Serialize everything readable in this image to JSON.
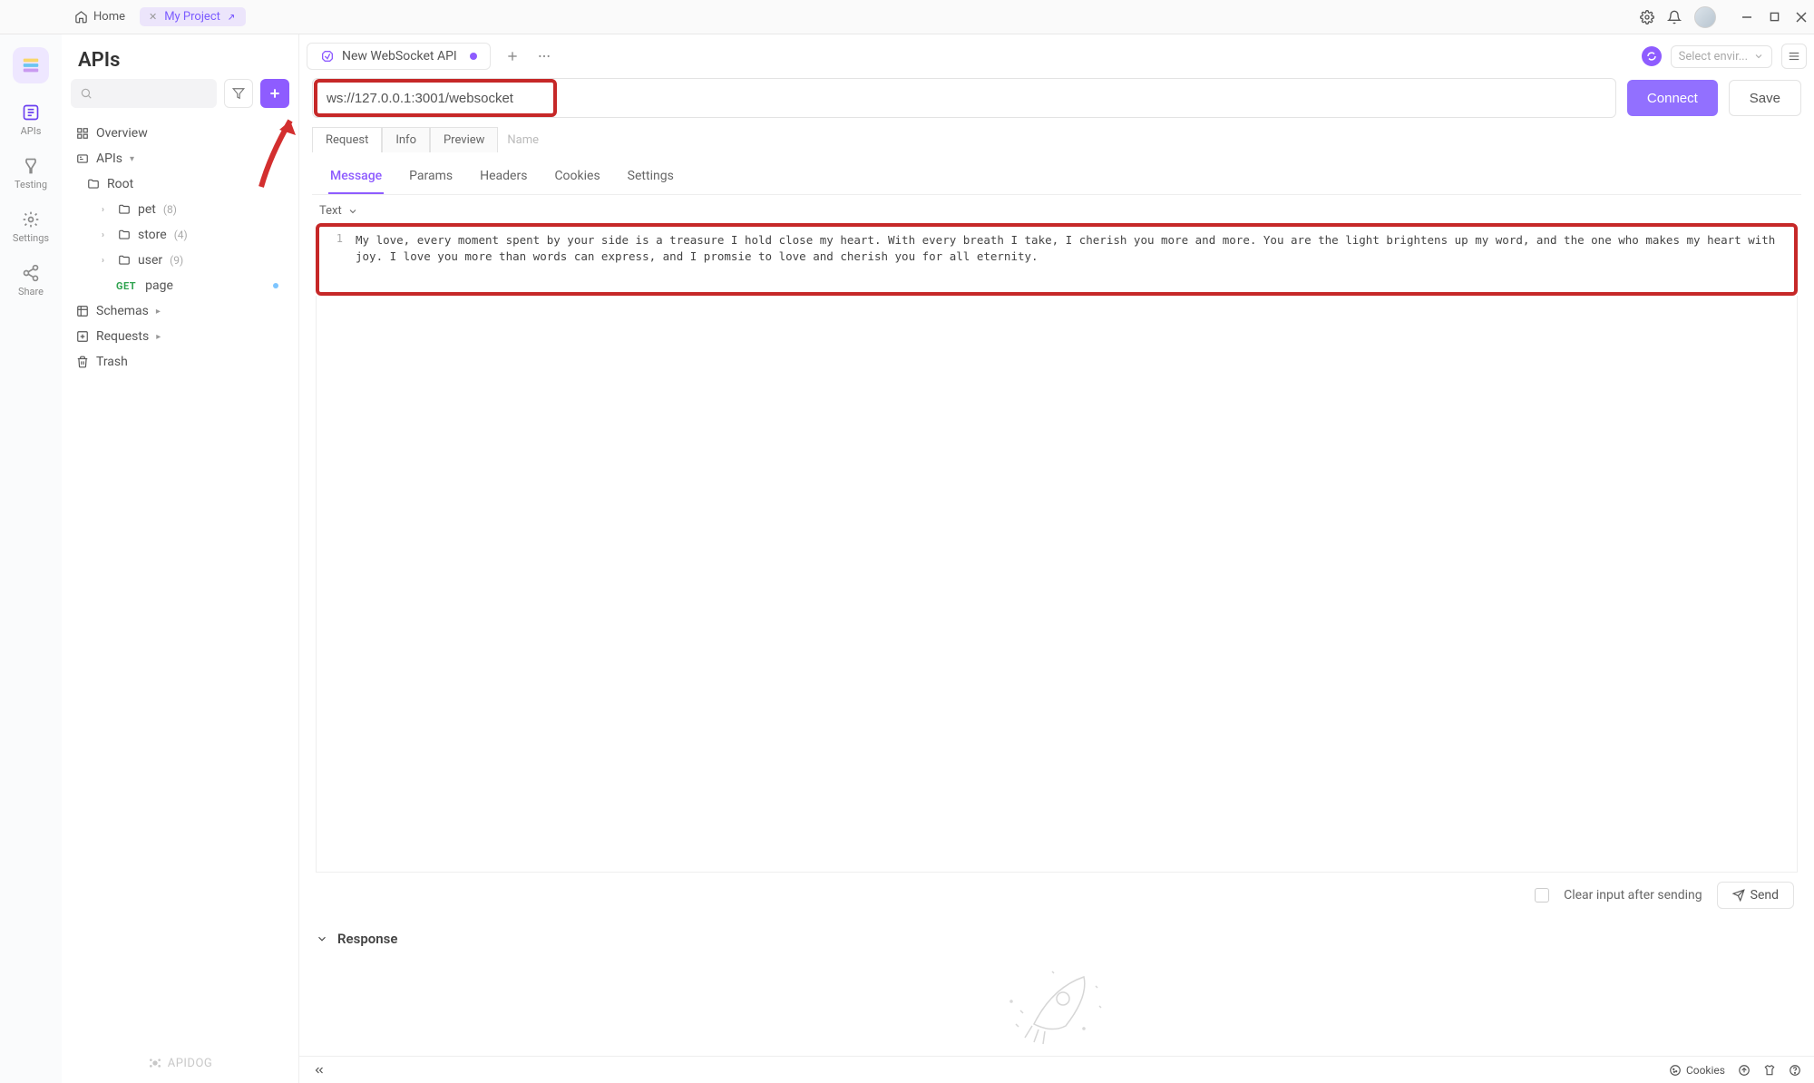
{
  "titlebar": {
    "home_label": "Home",
    "project_label": "My Project"
  },
  "rail": {
    "apis": "APIs",
    "testing": "Testing",
    "settings": "Settings",
    "share": "Share"
  },
  "sidebar": {
    "title": "APIs",
    "overview": "Overview",
    "apis_node": "APIs",
    "root": "Root",
    "items": [
      {
        "label": "pet",
        "count": "(8)"
      },
      {
        "label": "store",
        "count": "(4)"
      },
      {
        "label": "user",
        "count": "(9)"
      }
    ],
    "page_method": "GET",
    "page_label": "page",
    "schemas": "Schemas",
    "requests": "Requests",
    "trash": "Trash",
    "footer_brand": "APIDOG"
  },
  "doc_tab": {
    "label": "New WebSocket API"
  },
  "env": {
    "placeholder": "Select envir..."
  },
  "url": {
    "value": "ws://127.0.0.1:3001/websocket",
    "connect": "Connect",
    "save": "Save"
  },
  "subtabs": {
    "request": "Request",
    "info": "Info",
    "preview": "Preview",
    "name_placeholder": "Name"
  },
  "msg_tabs": {
    "message": "Message",
    "params": "Params",
    "headers": "Headers",
    "cookies": "Cookies",
    "settings": "Settings"
  },
  "editor": {
    "type_label": "Text",
    "line_no": "1",
    "content": "My love, every moment spent by your side is a treasure I hold close my heart. With every breath I take, I cherish you more and more. You are the light brightens up my word, and the one who makes my heart with joy. I love you more than words can express, and I promsie to love and cherish you for all eternity."
  },
  "send_row": {
    "clear_label": "Clear input after sending",
    "send_label": "Send"
  },
  "response": {
    "title": "Response"
  },
  "statusbar": {
    "cookies": "Cookies"
  }
}
